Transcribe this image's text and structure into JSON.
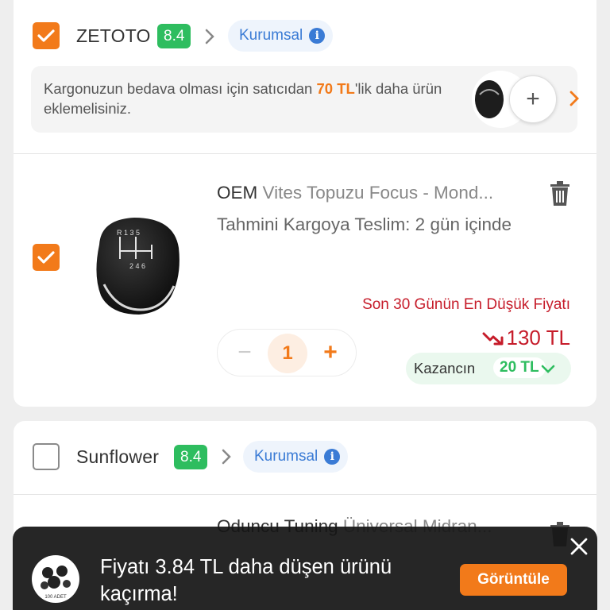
{
  "sellers": [
    {
      "name": "ZETOTO",
      "rating": "8.4",
      "badge": "Kurumsal",
      "checked": true,
      "cargo_notice": {
        "prefix": "Kargonuzun bedava olması için satıcıdan ",
        "amount": "70 TL",
        "suffix": "'lik daha ürün eklemelisiniz."
      },
      "item": {
        "brand": "OEM",
        "title": "Vites Topuzu Focus - Mond...",
        "delivery": "Tahmini Kargoya Teslim: 2 gün içinde",
        "lowest_price_label": "Son 30 Günün En Düşük Fiyatı",
        "price": "130 TL",
        "quantity": "1",
        "savings_label": "Kazancın",
        "savings_value": "20 TL",
        "checked": true,
        "image_icon": "gear-knob-icon"
      }
    },
    {
      "name": "Sunflower",
      "rating": "8.4",
      "badge": "Kurumsal",
      "checked": false,
      "item": {
        "brand": "Oduncu Tuning",
        "title": "Üniversal Midran..."
      }
    }
  ],
  "toast": {
    "message": "Fiyatı 3.84 TL daha düşen ürünü kaçırma!",
    "button_label": "Görüntüle",
    "avatar_caption": "100 ADET"
  },
  "colors": {
    "accent": "#f27a1a",
    "rating": "#2ebd5f",
    "corporate": "#3a7bd5",
    "price": "#c61c2a"
  }
}
